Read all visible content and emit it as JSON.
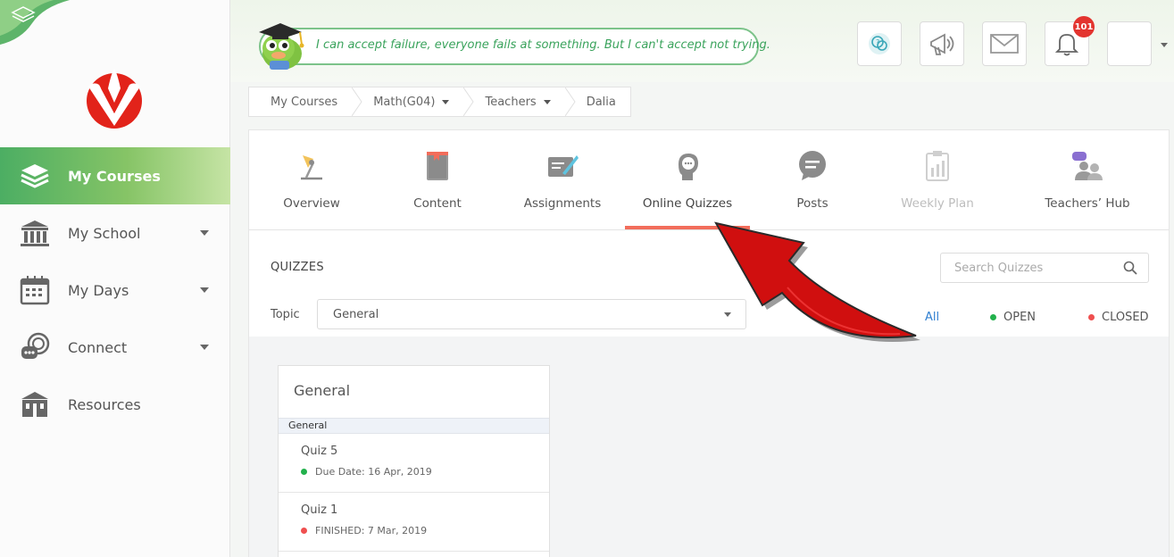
{
  "quote": "I can accept failure, everyone fails at something. But I can't accept not trying.",
  "notifications": {
    "count": "101"
  },
  "sidebar": {
    "items": [
      {
        "label": "My Courses",
        "icon": "layers-icon",
        "active": true
      },
      {
        "label": "My School",
        "icon": "school-building-icon"
      },
      {
        "label": "My Days",
        "icon": "calendar-icon"
      },
      {
        "label": "Connect",
        "icon": "chat-bubbles-icon"
      },
      {
        "label": "Resources",
        "icon": "library-icon"
      }
    ]
  },
  "breadcrumb": [
    "My Courses",
    "Math(G04)",
    "Teachers",
    "Dalia"
  ],
  "tabs": [
    {
      "label": "Overview",
      "icon": "desk-lamp-icon"
    },
    {
      "label": "Content",
      "icon": "book-icon"
    },
    {
      "label": "Assignments",
      "icon": "edit-board-icon"
    },
    {
      "label": "Online Quizzes",
      "icon": "head-quiz-icon",
      "active": true
    },
    {
      "label": "Posts",
      "icon": "speech-bubble-icon"
    },
    {
      "label": "Weekly Plan",
      "icon": "clipboard-chart-icon",
      "disabled": true
    },
    {
      "label": "Teachers’ Hub",
      "icon": "teachers-group-icon"
    }
  ],
  "quizzes": {
    "title": "QUIZZES",
    "search_placeholder": "Search Quizzes",
    "topic_label": "Topic",
    "topic_value": "General",
    "filters": {
      "all": "All",
      "open": "OPEN",
      "closed": "CLOSED"
    },
    "colors": {
      "open": "#22b14c",
      "closed": "#ef4f4f",
      "accent": "#f26d5b"
    }
  },
  "card": {
    "title": "General",
    "group": "General",
    "items": [
      {
        "name": "Quiz 5",
        "meta": "Due Date: 16 Apr, 2019",
        "status": "open"
      },
      {
        "name": "Quiz 1",
        "meta": "FINISHED: 7 Mar, 2019",
        "status": "closed"
      }
    ]
  }
}
